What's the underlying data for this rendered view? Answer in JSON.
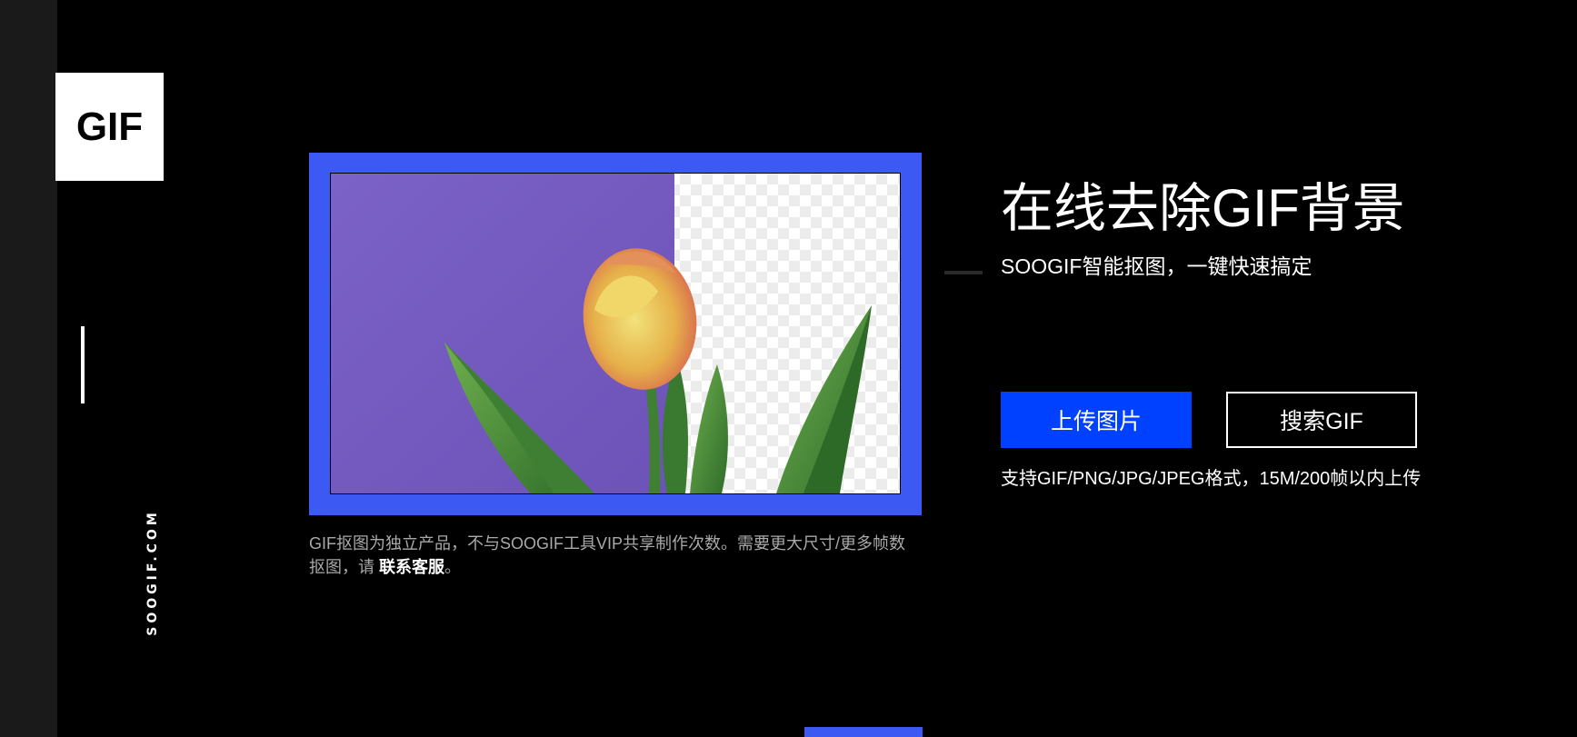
{
  "logo": {
    "text": "GIF"
  },
  "side": {
    "brand": "SOOGIF.COM"
  },
  "hero": {
    "title": "在线去除GIF背景",
    "subtitle": "SOOGIF智能抠图，一键快速搞定",
    "upload_label": "上传图片",
    "search_label": "搜索GIF",
    "support_text": "支持GIF/PNG/JPG/JPEG格式，15M/200帧以内上传"
  },
  "note": {
    "text": "GIF抠图为独立产品，不与SOOGIF工具VIP共享制作次数。需要更大尺寸/更多帧数抠图，请 ",
    "link": "联系客服",
    "suffix": "。"
  },
  "colors": {
    "accent": "#3d59f3",
    "primary_button": "#0040ff",
    "background": "#000000",
    "demo_purple": "#7a62c4"
  },
  "icons": {
    "logo": "gif-logo",
    "demo": "tulip-demo-image"
  }
}
